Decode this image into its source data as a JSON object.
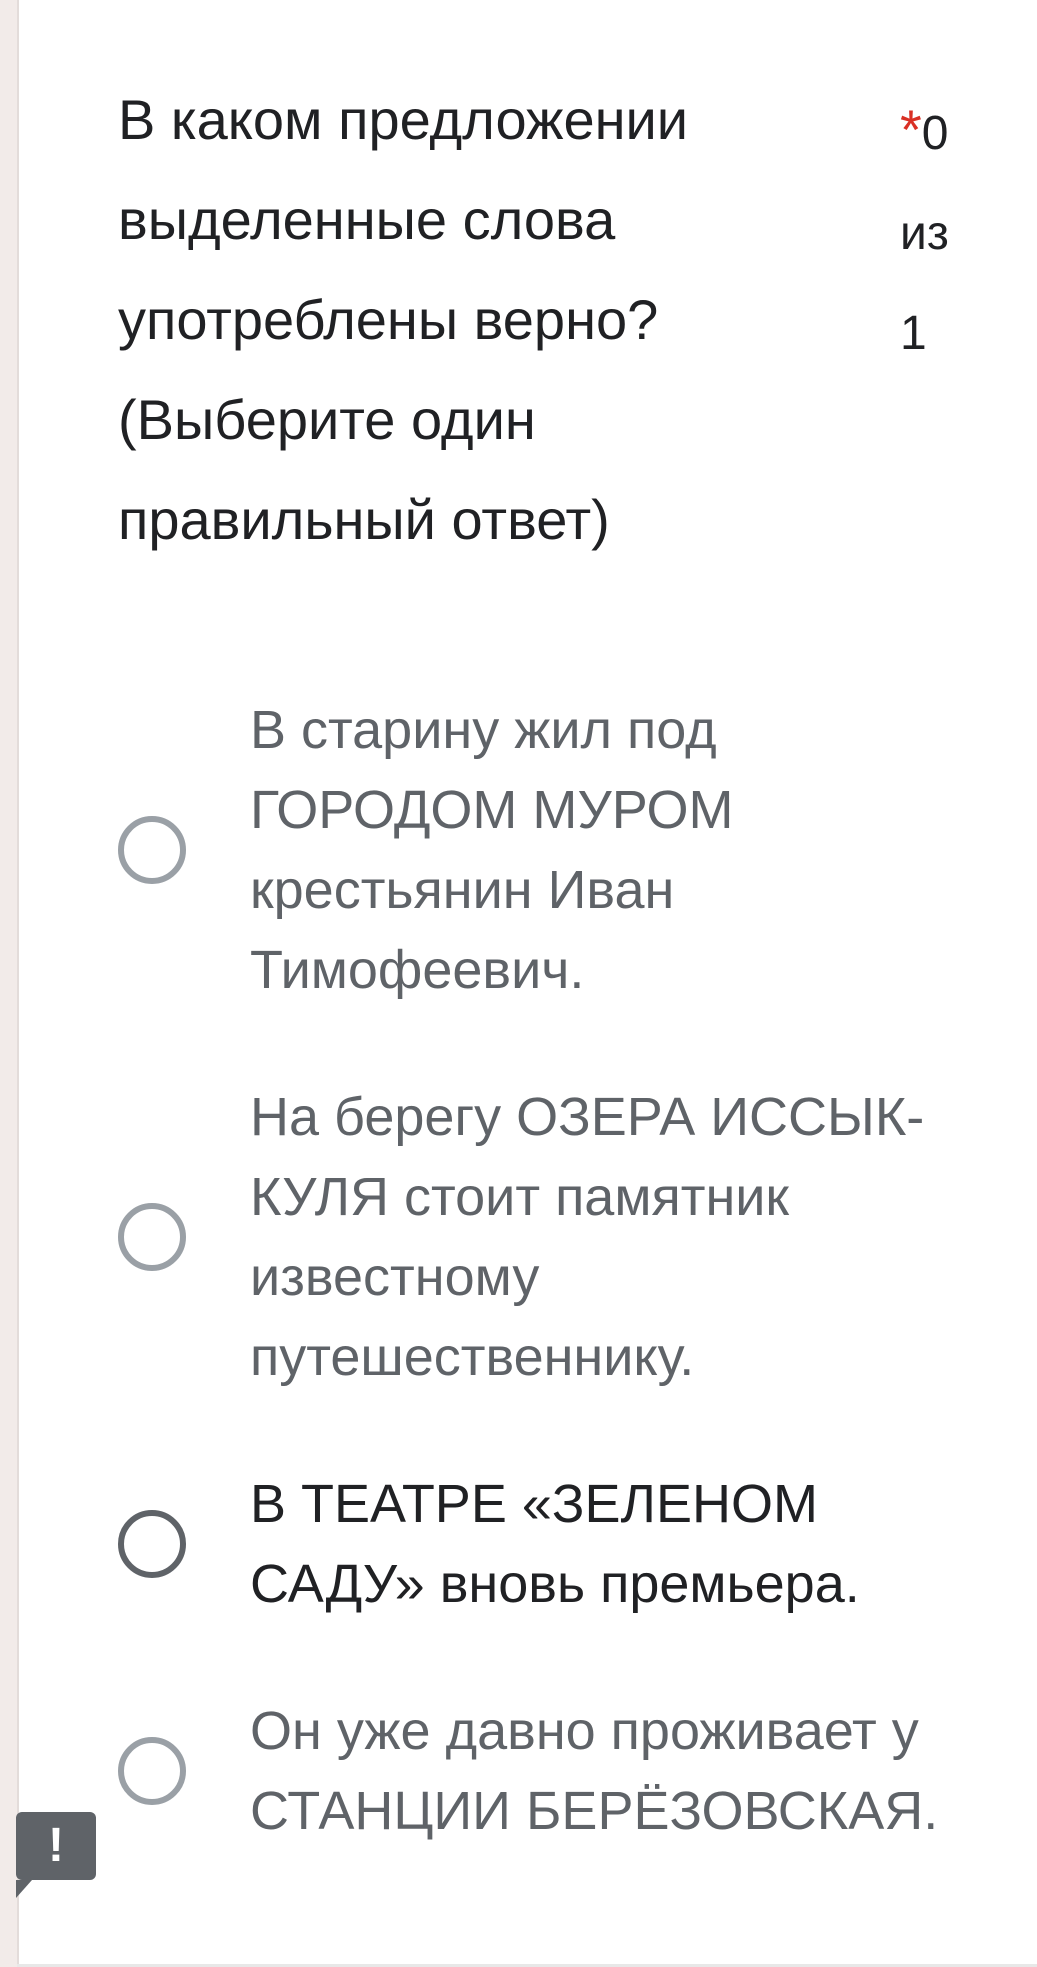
{
  "question": {
    "text": "В каком предложении выделенные слова употреблены верно? (Выберите один правильный ответ)",
    "required_mark": "*",
    "points_value": "0",
    "points_of": "из",
    "points_total": "1"
  },
  "options": [
    {
      "label": "В старину жил под ГОРОДОМ МУРОМ крестьянин Иван Тимофеевич."
    },
    {
      "label": "На берегу ОЗЕРА ИССЫК-КУЛЯ стоит памятник известному путешественнику."
    },
    {
      "label": "В ТЕАТРЕ «ЗЕЛЕНОМ САДУ» вновь премьера."
    },
    {
      "label": "Он уже давно проживает у СТАНЦИИ БЕРЁЗОВСКАЯ."
    }
  ],
  "feedback": {
    "alert_symbol": "!",
    "alert_icon": "alert-icon"
  },
  "colors": {
    "required": "#d93025",
    "text_primary": "#202124",
    "text_secondary": "#5f6368",
    "radio_border": "#9aa0a6"
  }
}
